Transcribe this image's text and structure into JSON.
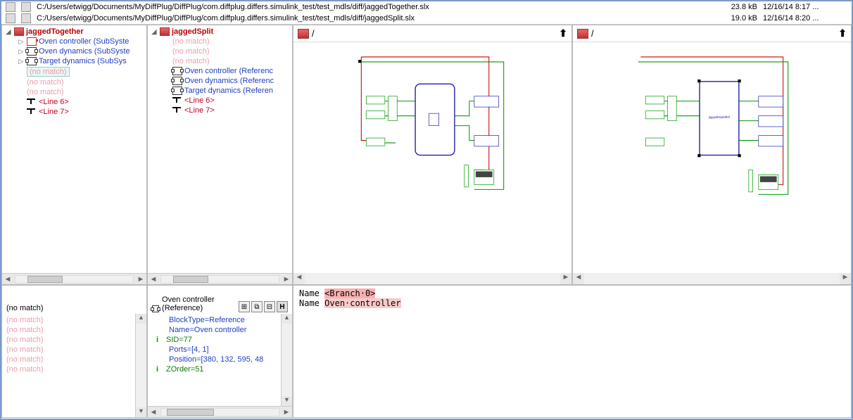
{
  "files": {
    "left": {
      "path": "C:/Users/etwigg/Documents/MyDiffPlug/DiffPlug/com.diffplug.differs.simulink_test/test_mdls/diff/jaggedTogether.slx",
      "size": "23.8 kB",
      "date": "12/16/14 8:17 ..."
    },
    "right": {
      "path": "C:/Users/etwigg/Documents/MyDiffPlug/DiffPlug/com.diffplug.differs.simulink_test/test_mdls/diff/jaggedSplit.slx",
      "size": "19.0 kB",
      "date": "12/16/14 8:20 ..."
    }
  },
  "tree_left": {
    "root": "jaggedTogether",
    "items": [
      {
        "text": "Oven controller (SubSyste",
        "color": "blue",
        "icon": "ref",
        "expand": "▷"
      },
      {
        "text": "Oven dynamics (SubSyste",
        "color": "blue",
        "icon": "block",
        "expand": "▷"
      },
      {
        "text": "Target dynamics (SubSys",
        "color": "blue",
        "icon": "block",
        "expand": "▷"
      },
      {
        "text": "(no match)",
        "color": "box"
      },
      {
        "text": "(no match)",
        "color": "pink"
      },
      {
        "text": "(no match)",
        "color": "pink"
      },
      {
        "text": "<Line 6>",
        "color": "red",
        "icon": "line"
      },
      {
        "text": "<Line 7>",
        "color": "red",
        "icon": "line"
      }
    ]
  },
  "tree_right": {
    "root": "jaggedSplit",
    "items": [
      {
        "text": "(no match)",
        "color": "pink"
      },
      {
        "text": "(no match)",
        "color": "pink"
      },
      {
        "text": "(no match)",
        "color": "pink"
      },
      {
        "text": "Oven controller (Referenc",
        "color": "blue",
        "icon": "block"
      },
      {
        "text": "Oven dynamics (Referenc",
        "color": "blue",
        "icon": "block"
      },
      {
        "text": "Target dynamics (Referen",
        "color": "blue",
        "icon": "block"
      },
      {
        "text": "<Line 6>",
        "color": "red",
        "icon": "line"
      },
      {
        "text": "<Line 7>",
        "color": "red",
        "icon": "line"
      }
    ]
  },
  "diagram_left": {
    "crumb": "/"
  },
  "diagram_right": {
    "crumb": "/"
  },
  "prop_left": {
    "header": "(no match)",
    "lines": [
      "(no match)",
      "(no match)",
      "(no match)",
      "(no match)",
      "(no match)",
      "(no match)"
    ]
  },
  "prop_right": {
    "header": "Oven controller (Reference)",
    "lines": [
      {
        "text": "BlockType=Reference",
        "color": "blue"
      },
      {
        "text": "Name=Oven controller",
        "color": "blue"
      },
      {
        "text": "SID=77",
        "color": "green",
        "info": true
      },
      {
        "text": "Ports=[4, 1]",
        "color": "blue"
      },
      {
        "text": "Position=[380, 132, 595, 48",
        "color": "blue"
      },
      {
        "text": "ZOrder=51",
        "color": "green",
        "info": true
      }
    ]
  },
  "name_diff": {
    "row1_label": "Name",
    "row1_value": "<Branch·0>",
    "row2_label": "Name",
    "row2_value": "Oven·controller"
  }
}
